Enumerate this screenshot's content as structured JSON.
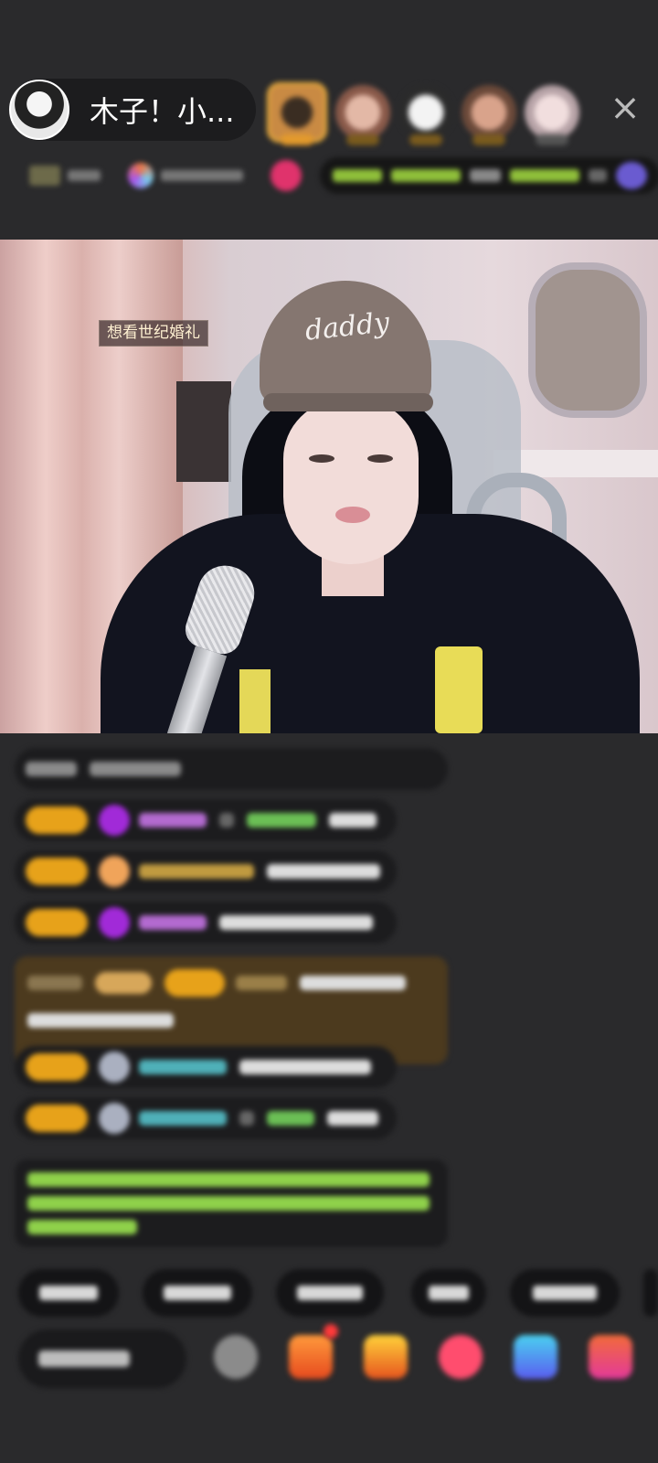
{
  "header": {
    "host_name": "木子！小...",
    "close_symbol": "×"
  },
  "video": {
    "caption": "想看世纪婚礼",
    "cap_logo_text": "daddy"
  },
  "colors": {
    "background": "#2a2a2c",
    "pill_background": "#1c1c1e",
    "level_badge": "#e7a21a",
    "highlight_message": "#4c3a1e",
    "notice_text": "#8fd14a"
  },
  "icons": [
    "host-avatar",
    "viewer-avatar",
    "close-icon",
    "gift-icon",
    "emoji-icon"
  ]
}
